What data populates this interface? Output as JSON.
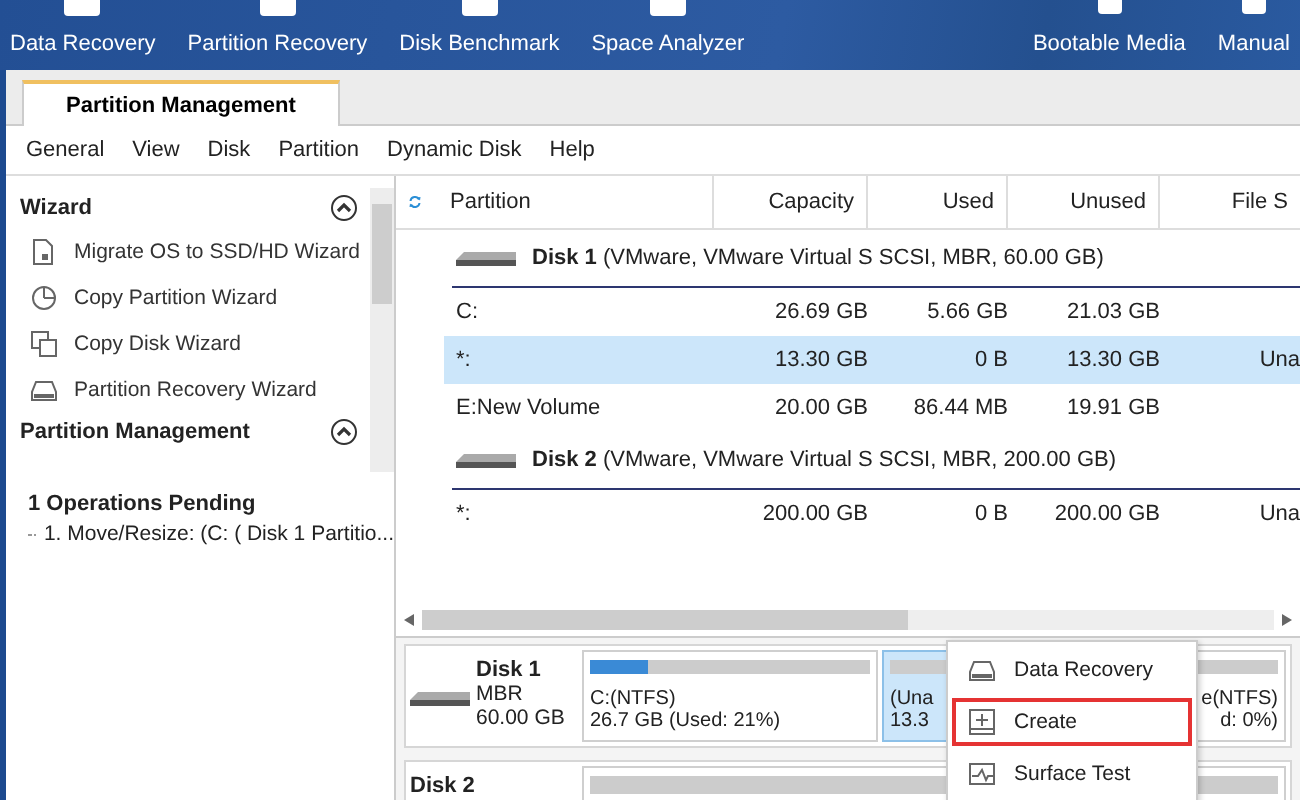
{
  "toolbar": {
    "left": [
      "Data Recovery",
      "Partition Recovery",
      "Disk Benchmark",
      "Space Analyzer"
    ],
    "right": [
      "Bootable Media",
      "Manual"
    ]
  },
  "tabs": [
    {
      "label": "Partition Management",
      "selected": true
    }
  ],
  "menu": [
    "General",
    "View",
    "Disk",
    "Partition",
    "Dynamic Disk",
    "Help"
  ],
  "sidebar": {
    "sections": [
      {
        "title": "Wizard",
        "expanded": true,
        "items": [
          {
            "label": "Migrate OS to SSD/HD Wizard",
            "kind": "migrate"
          },
          {
            "label": "Copy Partition Wizard",
            "kind": "copy-partition"
          },
          {
            "label": "Copy Disk Wizard",
            "kind": "copy-disk"
          },
          {
            "label": "Partition Recovery Wizard",
            "kind": "recovery"
          }
        ]
      },
      {
        "title": "Partition Management",
        "expanded": true
      }
    ],
    "pending": {
      "title": "1 Operations Pending",
      "items": [
        "1. Move/Resize: (C: ( Disk 1 Partitio..."
      ]
    }
  },
  "table": {
    "columns": [
      "Partition",
      "Capacity",
      "Used",
      "Unused",
      "File S"
    ],
    "disks": [
      {
        "name": "Disk 1",
        "info": "(VMware, VMware Virtual S SCSI, MBR, 60.00 GB)",
        "rows": [
          {
            "cells": [
              "C:",
              "26.69 GB",
              "5.66 GB",
              "21.03 GB"
            ],
            "selected": false
          },
          {
            "cells": [
              "*:",
              "13.30 GB",
              "0 B",
              "13.30 GB",
              "Una"
            ],
            "selected": true
          },
          {
            "cells": [
              "E:New Volume",
              "20.00 GB",
              "86.44 MB",
              "19.91 GB"
            ],
            "selected": false
          }
        ]
      },
      {
        "name": "Disk 2",
        "info": "(VMware, VMware Virtual S SCSI, MBR, 200.00 GB)",
        "rows": [
          {
            "cells": [
              "*:",
              "200.00 GB",
              "0 B",
              "200.00 GB",
              "Una"
            ],
            "selected": false
          }
        ]
      }
    ]
  },
  "disk_map": [
    {
      "name": "Disk 1",
      "type": "MBR",
      "size": "60.00 GB",
      "partitions": [
        {
          "line1": "C:(NTFS)",
          "line2": "26.7 GB (Used: 21%)",
          "level": 0.21,
          "selected": false
        },
        {
          "line1": "(Una",
          "line2": "13.3",
          "selected": true
        },
        {
          "line1": "e(NTFS)",
          "line2": "d: 0%)",
          "selected": false
        }
      ]
    },
    {
      "name": "Disk 2"
    }
  ],
  "context_menu": [
    {
      "label": "Data Recovery",
      "kind": "recovery",
      "selected": false
    },
    {
      "label": "Create",
      "kind": "create",
      "selected": true
    },
    {
      "label": "Surface Test",
      "kind": "test",
      "selected": false
    }
  ]
}
